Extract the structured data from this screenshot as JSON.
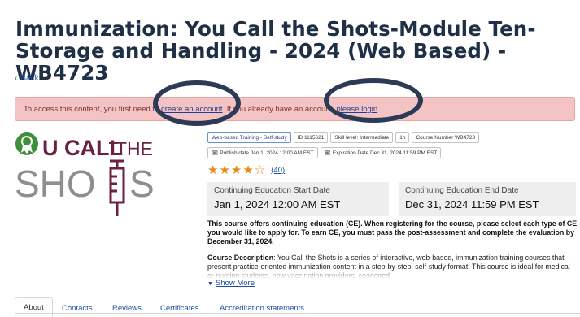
{
  "page": {
    "title": "Immunization: You Call the Shots-Module Ten-Storage and Handling - 2024 (Web Based) - WB4723",
    "back_label": "Back"
  },
  "alert": {
    "text_before": "To access this content, you first need to ",
    "link_create": "create an account",
    "text_middle": ". If you already have an account, ",
    "link_login": "please login",
    "text_after": "."
  },
  "logo": {
    "line1": "U CALL",
    "line1b": "THE",
    "line2a": "SHO",
    "line2b": "S",
    "colors": {
      "maroon": "#6b2242",
      "gray": "#8e8e8e",
      "green": "#3d8f3a"
    }
  },
  "tags": {
    "type": "Web-based Training - Self-study",
    "id": "ID 1115621",
    "skill": "Skill level: Intermediate",
    "duration": "1h",
    "course_number": "Course Number WB4723",
    "publish": "Publish date Jan 1, 2024 12:00 AM EST",
    "expiration": "Expiration Date Dec 31, 2024 11:59 PM EST"
  },
  "rating": {
    "stars": "★★★★☆",
    "count": "(40)",
    "value": 4.5,
    "max": 5
  },
  "ce": {
    "start_label": "Continuing Education Start Date",
    "start_value": "Jan 1, 2024 12:00 AM EST",
    "end_label": "Continuing Education End Date",
    "end_value": "Dec 31, 2024 11:59 PM EST",
    "note": "This course offers continuing education (CE). When registering for the course, please select each type of CE you would like to apply for. To earn CE, you must pass the post-assessment and complete the evaluation by December 31, 2024."
  },
  "description": {
    "label": "Course Description",
    "text": ": You Call the Shots is a series of interactive, web-based, immunization training courses that present practice-oriented immunization content in a step-by-step, self-study format. This course is ideal for medical or nursing students, new vaccination providers, seasoned"
  },
  "show_more": "Show More",
  "tabs": {
    "about": "About",
    "contacts": "Contacts",
    "reviews": "Reviews",
    "certificates": "Certificates",
    "accreditation": "Accreditation statements"
  },
  "colors": {
    "accent": "#1a4fa3",
    "alert_bg": "#f4c4c4",
    "star": "#e58b16",
    "annotation_circle": "#2d3a55"
  }
}
